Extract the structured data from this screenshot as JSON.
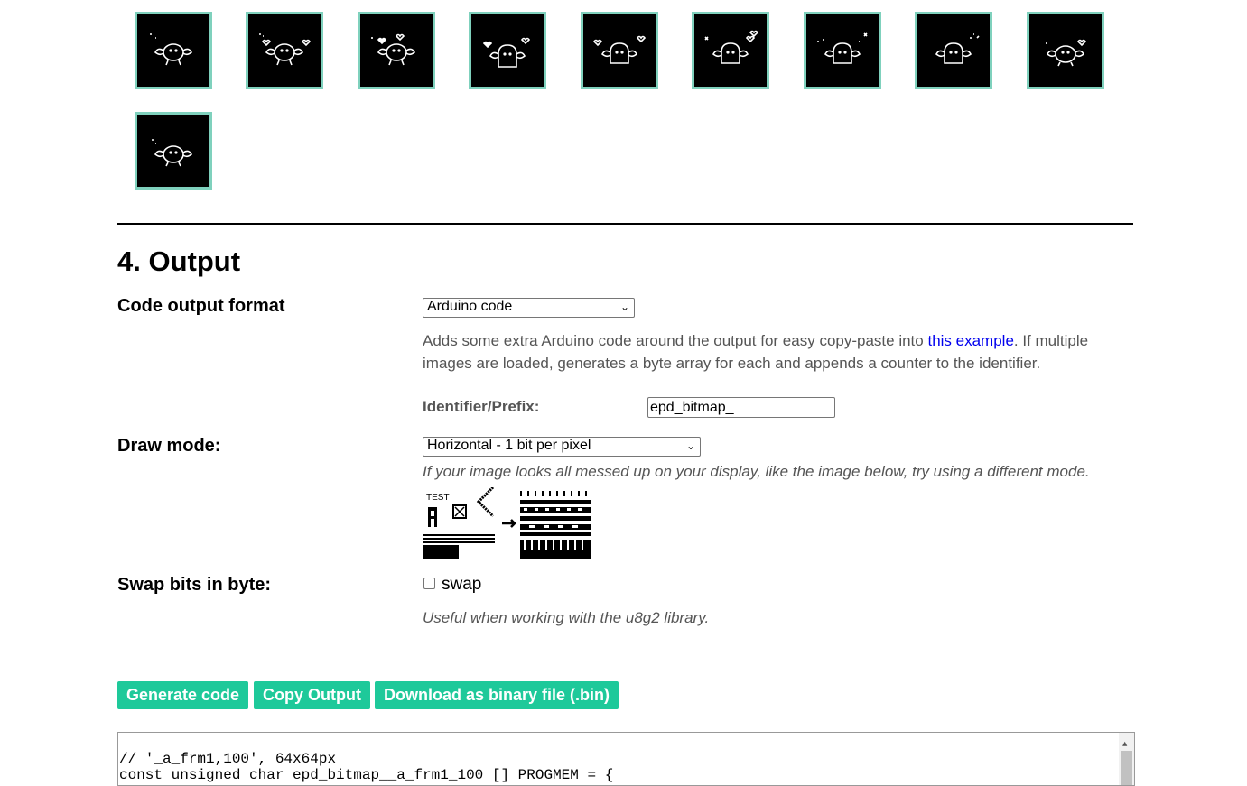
{
  "section": {
    "title": "4. Output"
  },
  "thumbnails": {
    "count": 10
  },
  "code_output": {
    "label": "Code output format",
    "selected": "Arduino code",
    "description_before": "Adds some extra Arduino code around the output for easy copy-paste into ",
    "link_text": "this example",
    "description_line1_end": ". If multiple",
    "description_line2": "images are loaded, generates a byte array for each and appends a counter to the identifier.",
    "identifier_label": "Identifier/Prefix:",
    "identifier_value": "epd_bitmap_"
  },
  "draw_mode": {
    "label": "Draw mode:",
    "selected": "Horizontal - 1 bit per pixel",
    "hint": "If your image looks all messed up on your display, like the image below, try using a different mode.",
    "sample_text": "TEST"
  },
  "swap_bits": {
    "label": "Swap bits in byte:",
    "checkbox_label": "swap",
    "checked": false,
    "hint": "Useful when working with the u8g2 library."
  },
  "buttons": {
    "generate": "Generate code",
    "copy": "Copy Output",
    "download": "Download as binary file (.bin)"
  },
  "output": {
    "line1": "// '_a_frm1,100', 64x64px",
    "line2": "const unsigned char epd_bitmap__a_frm1_100 [] PROGMEM = {"
  },
  "colors": {
    "accent": "#1ec99a",
    "thumb_border": "#7fd1bd"
  }
}
